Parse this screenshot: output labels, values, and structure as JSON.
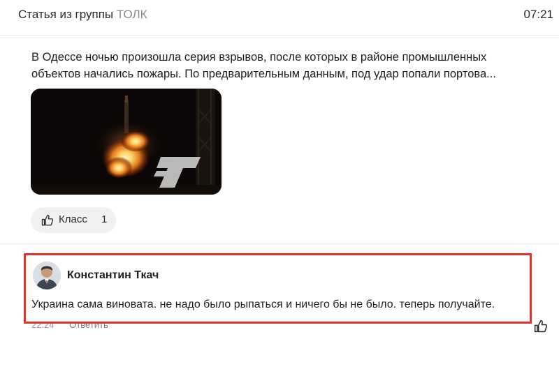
{
  "header": {
    "title_prefix": "Статья из группы",
    "group_name": "ТОЛК",
    "time": "07:21"
  },
  "post": {
    "text_line1": "В Одессе ночью произошла серия взрывов, после которых в районе промышленных",
    "text_line2": "объектов начались пожары. По предварительным данным, под удар попали портова...",
    "image_icon": "explosion-photo-with-tolk-logo",
    "like_label": "Класс",
    "like_count": "1"
  },
  "comment": {
    "author": "Константин Ткач",
    "text": "Украина сама виновата. не надо было рыпаться и ничего бы не было. теперь получайте.",
    "time": "22:24",
    "reply_label": "Ответить",
    "highlight_color": "#e4322b"
  },
  "icons": {
    "like_icon": "thumb-up-icon",
    "comment_like_icon": "thumb-up-icon"
  }
}
